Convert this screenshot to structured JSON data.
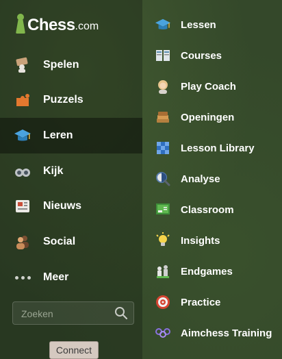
{
  "logo": {
    "word": "Chess",
    "suffix": ".com"
  },
  "nav": {
    "items": [
      {
        "label": "Spelen",
        "icon": "play-icon"
      },
      {
        "label": "Puzzels",
        "icon": "puzzle-icon"
      },
      {
        "label": "Leren",
        "icon": "graduation-cap-icon",
        "active": true
      },
      {
        "label": "Kijk",
        "icon": "binoculars-icon"
      },
      {
        "label": "Nieuws",
        "icon": "newspaper-icon"
      },
      {
        "label": "Social",
        "icon": "people-icon"
      },
      {
        "label": "Meer",
        "icon": "more-dots-icon"
      }
    ]
  },
  "search": {
    "placeholder": "Zoeken"
  },
  "connect": {
    "label": "Connect"
  },
  "submenu": {
    "items": [
      {
        "label": "Lessen",
        "icon": "graduation-cap-icon"
      },
      {
        "label": "Courses",
        "icon": "book-icon"
      },
      {
        "label": "Play Coach",
        "icon": "coach-icon"
      },
      {
        "label": "Openingen",
        "icon": "opening-book-icon"
      },
      {
        "label": "Lesson Library",
        "icon": "library-icon"
      },
      {
        "label": "Analyse",
        "icon": "analysis-icon"
      },
      {
        "label": "Classroom",
        "icon": "classroom-icon"
      },
      {
        "label": "Insights",
        "icon": "lightbulb-icon"
      },
      {
        "label": "Endgames",
        "icon": "endgames-icon"
      },
      {
        "label": "Practice",
        "icon": "target-icon"
      },
      {
        "label": "Aimchess Training",
        "icon": "aimchess-icon"
      }
    ]
  }
}
